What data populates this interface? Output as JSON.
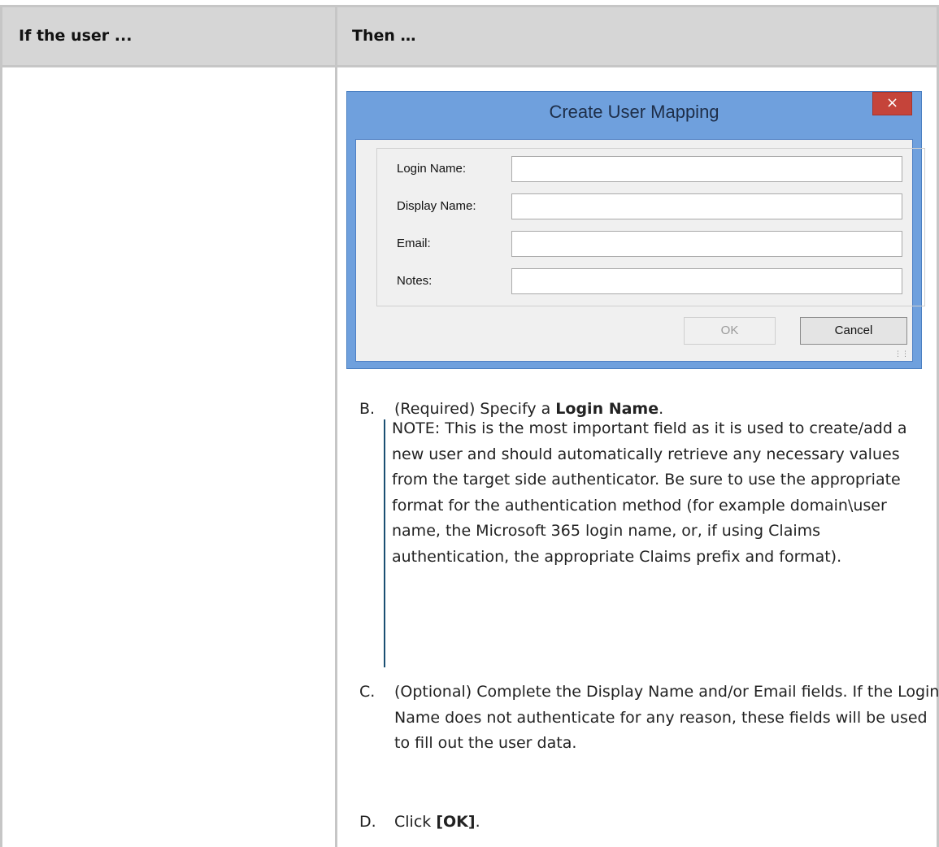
{
  "table": {
    "header": {
      "col1": "If the user ...",
      "col2": "Then …"
    }
  },
  "dialog": {
    "title": "Create User Mapping",
    "close_glyph": "×",
    "fields": [
      {
        "label": "Login Name:",
        "value": ""
      },
      {
        "label": "Display Name:",
        "value": ""
      },
      {
        "label": "Email:",
        "value": ""
      },
      {
        "label": "Notes:",
        "value": ""
      }
    ],
    "ok_label": "OK",
    "cancel_label": "Cancel"
  },
  "steps": {
    "b": {
      "letter": "B.",
      "pre": "(Required) Specify a ",
      "bold": "Login Name",
      "post": "."
    },
    "note": "NOTE: This is the most important field as it is used to create/add a new user and should automatically retrieve any necessary values from the target side authenticator. Be sure to use the appropriate format for the authentication method (for example domain\\user name, the Microsoft 365 login name, or, if using Claims authentication, the appropriate Claims prefix and format).",
    "c": {
      "letter": "C.",
      "text": "(Optional) Complete the Display Name and/or Email fields. If the Login Name does not authenticate for any reason, these fields will be used to fill out the user data."
    },
    "d": {
      "letter": "D.",
      "pre": "Click ",
      "bold": "[OK]",
      "post": "."
    }
  },
  "colors": {
    "header_bg": "#d6d6d6",
    "dialog_frame": "#6fa0dd",
    "close_button": "#c5443a",
    "note_bar": "#1b4f72"
  }
}
